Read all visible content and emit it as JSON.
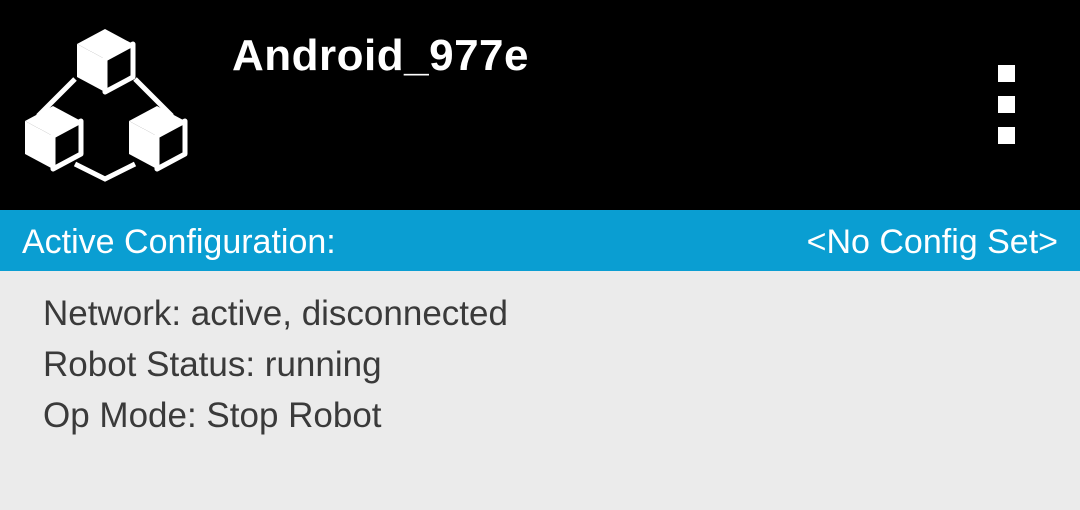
{
  "header": {
    "device_name": "Android_977e",
    "logo_icon": "robot-controller-cubes-icon",
    "menu_icon": "overflow-menu-icon",
    "background_color": "#000000"
  },
  "config_bar": {
    "label": "Active Configuration:",
    "value": "<No Config Set>",
    "background_color": "#0a9ed2"
  },
  "status": {
    "network": "Network: active, disconnected",
    "robot_status": "Robot Status: running",
    "op_mode": "Op Mode: Stop Robot"
  }
}
